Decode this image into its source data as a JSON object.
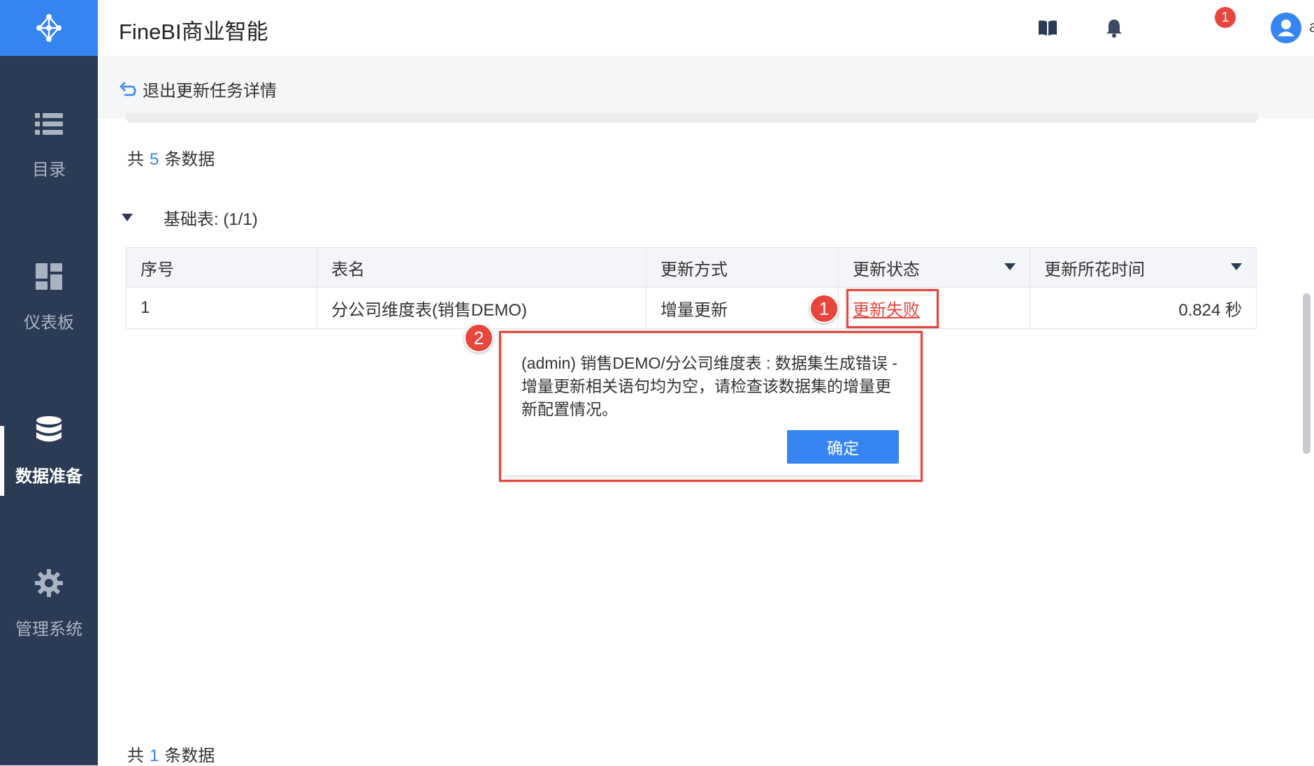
{
  "app": {
    "title": "FineBI商业智能"
  },
  "header": {
    "notification_count": "1",
    "username": "admin",
    "icons": [
      "book-icon",
      "bell-icon",
      "user-avatar-icon",
      "chevron-down-icon"
    ]
  },
  "sidebar": {
    "items": [
      {
        "label": "目录",
        "icon": "list-icon",
        "active": false
      },
      {
        "label": "仪表板",
        "icon": "dashboard-icon",
        "active": false
      },
      {
        "label": "数据准备",
        "icon": "database-icon",
        "active": true
      },
      {
        "label": "管理系统",
        "icon": "gear-icon",
        "active": false
      }
    ]
  },
  "subheader": {
    "back_label": "退出更新任务详情"
  },
  "summary_top": {
    "prefix": "共",
    "count": "5",
    "suffix": "条数据"
  },
  "section": {
    "label": "基础表: (1/1)"
  },
  "table": {
    "columns": [
      "序号",
      "表名",
      "更新方式",
      "更新状态",
      "更新所花时间"
    ],
    "rows": [
      {
        "index": "1",
        "name": "分公司维度表(销售DEMO)",
        "method": "增量更新",
        "status": "更新失败",
        "duration": "0.824 秒"
      }
    ]
  },
  "annotations": {
    "step1": "1",
    "step2": "2",
    "color": "#e8453c"
  },
  "dialog": {
    "message": "(admin) 销售DEMO/分公司维度表 : 数据集生成错误 - 增量更新相关语句均为空，请检查该数据集的增量更新配置情况。",
    "ok_label": "确定"
  },
  "summary_bottom": {
    "prefix": "共",
    "count": "1",
    "suffix": "条数据"
  },
  "colors": {
    "sidebar": "#2c3b55",
    "accent": "#3685f2",
    "error": "#e8453c"
  }
}
